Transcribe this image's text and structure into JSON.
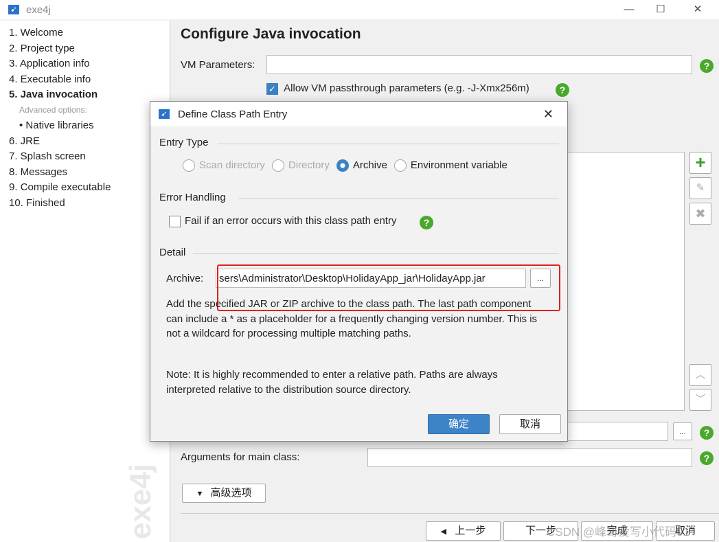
{
  "window": {
    "title": "exe4j"
  },
  "sidebar": {
    "steps": [
      "1. Welcome",
      "2. Project type",
      "3. Application info",
      "4. Executable info",
      "5. Java invocation",
      "Advanced options:",
      "Native libraries",
      "6. JRE",
      "7. Splash screen",
      "8. Messages",
      "9. Compile executable",
      "10. Finished"
    ],
    "watermark": "exe4j"
  },
  "main": {
    "heading": "Configure Java invocation",
    "vm_label": "VM Parameters:",
    "passthrough_label": "Allow VM passthrough parameters (e.g. -J-Xmx256m)",
    "args_label": "Arguments for main class:",
    "advanced_button": "高级选项",
    "dots": "..."
  },
  "nav": {
    "back": "上一步",
    "next": "下一步",
    "finish": "完成",
    "cancel": "取消"
  },
  "dialog": {
    "title": "Define Class Path Entry",
    "entry_type_heading": "Entry Type",
    "radios": [
      "Scan directory",
      "Directory",
      "Archive",
      "Environment variable"
    ],
    "error_heading": "Error Handling",
    "fail_label": "Fail if an error occurs with this class path entry",
    "detail_heading": "Detail",
    "archive_label": "Archive:",
    "archive_value": "sers\\Administrator\\Desktop\\HolidayApp_jar\\HolidayApp.jar",
    "browse": "...",
    "desc1": "Add the specified JAR or ZIP archive to the class path. The last path component can include a * as a placeholder for a frequently changing version number. This is not a wildcard for processing multiple matching paths.",
    "desc2": "Note: It is highly recommended to enter a relative path. Paths are always interpreted relative to the distribution source directory.",
    "ok": "确定",
    "cancel": "取消"
  },
  "watermark": "CSDN @峰哥爱写小代码01"
}
